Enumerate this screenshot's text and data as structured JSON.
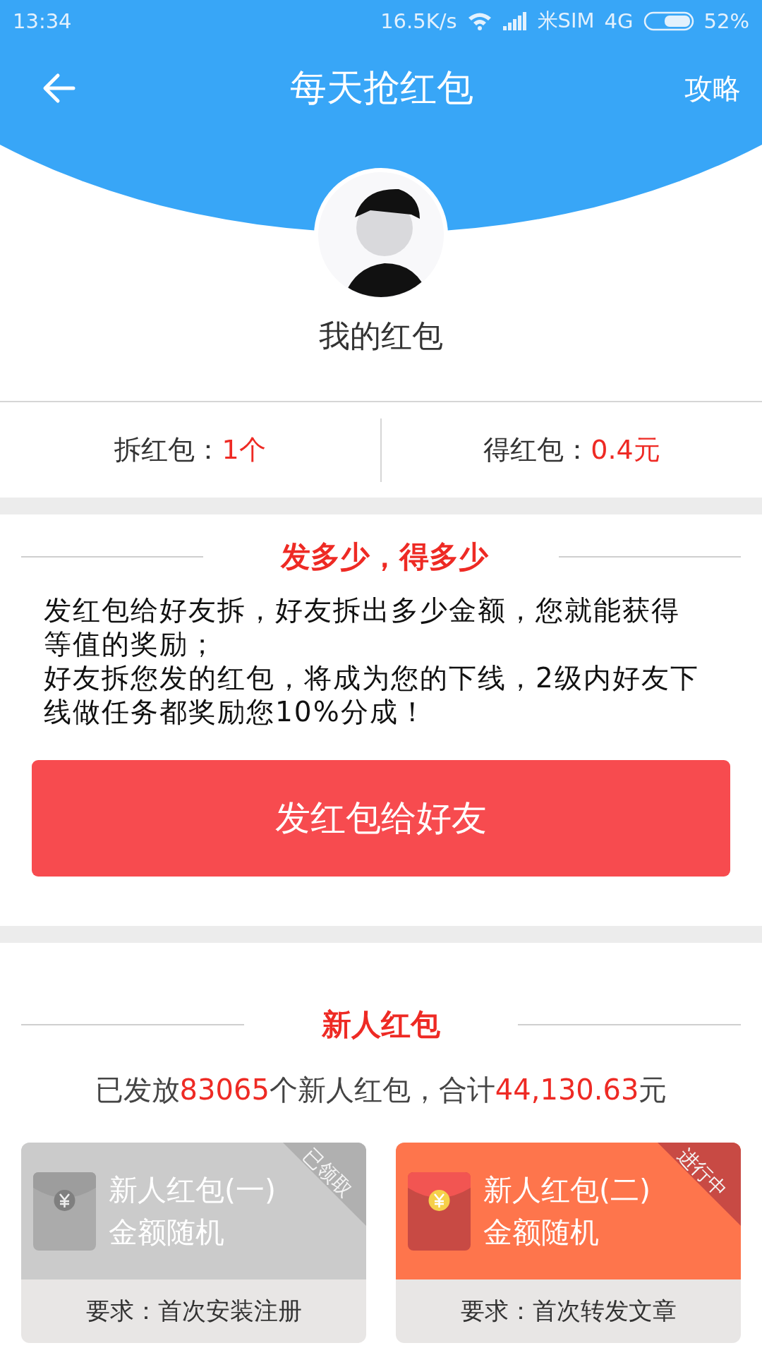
{
  "status_bar": {
    "time": "13:34",
    "speed": "16.5K/s",
    "carrier": "米SIM",
    "network": "4G",
    "battery": "52%"
  },
  "header": {
    "title": "每天抢红包",
    "action": "攻略"
  },
  "profile": {
    "name": "我的红包"
  },
  "stats": [
    {
      "label": "拆红包：",
      "value": "1个"
    },
    {
      "label": "得红包：",
      "value": "0.4元"
    }
  ],
  "promo": {
    "title": "发多少，得多少",
    "paragraphs": [
      "发红包给好友拆，好友拆出多少金额，您就能获得等值的奖励；",
      "好友拆您发的红包，将成为您的下线，2级内好友下线做任务都奖励您10%分成！"
    ],
    "button": "发红包给好友"
  },
  "newbie": {
    "title": "新人红包",
    "summary": [
      {
        "text": "已发放",
        "highlight": false
      },
      {
        "text": "83065",
        "highlight": true
      },
      {
        "text": "个新人红包，合计",
        "highlight": false
      },
      {
        "text": "44,130.63",
        "highlight": true
      },
      {
        "text": "元",
        "highlight": false
      }
    ],
    "cards": [
      {
        "kind": "claimed",
        "title": "新人红包(一)",
        "subtitle": "金额随机",
        "ribbon": "已领取",
        "requirement": "要求：首次安装注册"
      },
      {
        "kind": "active",
        "title": "新人红包(二)",
        "subtitle": "金额随机",
        "ribbon": "进行中",
        "requirement": "要求：首次转发文章"
      }
    ]
  }
}
